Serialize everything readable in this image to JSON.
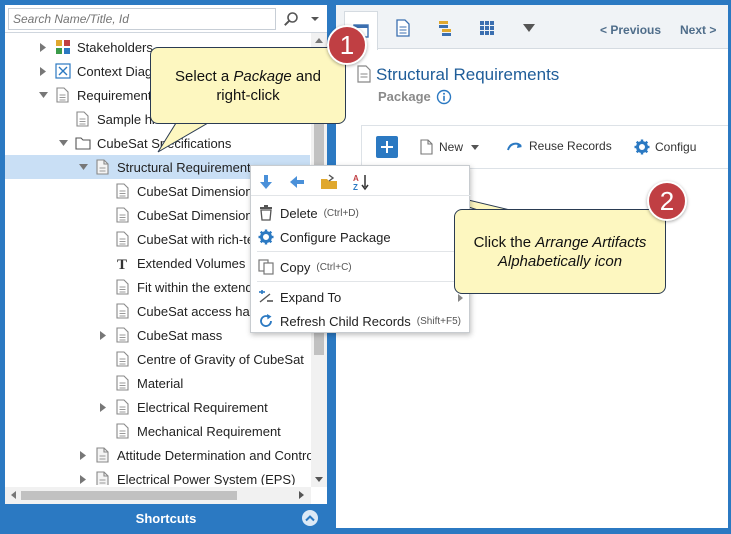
{
  "search": {
    "placeholder": "Search Name/Title, Id"
  },
  "tree": [
    {
      "label": "Stakeholders",
      "toggle": "collapsed",
      "icon": "stakeholders-icon",
      "indent": 1
    },
    {
      "label": "Context Diagram",
      "toggle": "collapsed",
      "icon": "context-diagram-icon",
      "indent": 1
    },
    {
      "label": "Requirements",
      "toggle": "expanded",
      "icon": "document-icon",
      "indent": 1
    },
    {
      "label": "Sample hi",
      "toggle": "none",
      "icon": "document-icon",
      "indent": 2
    },
    {
      "label": "CubeSat Specifications",
      "toggle": "expanded",
      "icon": "folder-icon",
      "indent": 2
    },
    {
      "label": "Structural Requirements",
      "toggle": "expanded",
      "icon": "package-icon",
      "indent": 3,
      "selected": true
    },
    {
      "label": "CubeSat Dimension",
      "toggle": "none",
      "icon": "document-icon",
      "indent": 4
    },
    {
      "label": "CubeSat Dimension",
      "toggle": "none",
      "icon": "document-icon",
      "indent": 4
    },
    {
      "label": "CubeSat with rich-text",
      "toggle": "none",
      "icon": "document-icon",
      "indent": 4
    },
    {
      "label": "Extended Volumes",
      "toggle": "none",
      "icon": "text-icon",
      "indent": 4
    },
    {
      "label": "Fit within the extended",
      "toggle": "none",
      "icon": "document-icon",
      "indent": 4
    },
    {
      "label": "CubeSat access hatch",
      "toggle": "none",
      "icon": "document-icon",
      "indent": 4
    },
    {
      "label": "CubeSat mass",
      "toggle": "collapsed",
      "icon": "document-icon",
      "indent": 4
    },
    {
      "label": "Centre of Gravity of CubeSat",
      "toggle": "none",
      "icon": "document-icon",
      "indent": 4
    },
    {
      "label": "Material",
      "toggle": "none",
      "icon": "document-icon",
      "indent": 4
    },
    {
      "label": "Electrical Requirement",
      "toggle": "collapsed",
      "icon": "document-icon",
      "indent": 4
    },
    {
      "label": "Mechanical Requirement",
      "toggle": "none",
      "icon": "document-icon",
      "indent": 4
    },
    {
      "label": "Attitude Determination and Control",
      "toggle": "collapsed",
      "icon": "package-icon",
      "indent": 3
    },
    {
      "label": "Electrical Power System (EPS)",
      "toggle": "collapsed",
      "icon": "package-icon",
      "indent": 3
    }
  ],
  "shortcuts": {
    "label": "Shortcuts"
  },
  "right_panel": {
    "tabs": [
      "tab-details-icon",
      "tab-document-icon",
      "tab-database-icon",
      "tab-grid-icon",
      "tab-more-icon"
    ],
    "previous_label": "< Previous",
    "next_label": "Next >",
    "title": "Structural Requirements",
    "subtitle": "Package",
    "toolbar": {
      "new_label": "New",
      "reuse_label": "Reuse Records",
      "configure_label": "Configu"
    }
  },
  "context_menu": {
    "icon_bar": [
      "move-down-icon",
      "move-left-icon",
      "move-to-folder-icon",
      "sort-az-icon"
    ],
    "items": [
      {
        "label": "Delete",
        "shortcut": "(Ctrl+D)",
        "icon": "trash-icon"
      },
      {
        "label": "Configure Package",
        "shortcut": "",
        "icon": "gear-icon"
      },
      {
        "label": "Copy",
        "shortcut": "(Ctrl+C)",
        "icon": "copy-icon"
      },
      {
        "label": "Expand To",
        "shortcut": "",
        "icon": "expand-to-icon"
      },
      {
        "label": "Refresh Child Records",
        "shortcut": "(Shift+F5)",
        "icon": "refresh-icon"
      }
    ]
  },
  "callouts": {
    "one": {
      "number": "1",
      "line1_a": "Select a ",
      "line1_em": "Package",
      "line1_b": " and",
      "line2": "right-click"
    },
    "two": {
      "number": "2",
      "line1_a": "Click the ",
      "line1_em": "Arrange Artifacts",
      "line2_em": "Alphabetically icon"
    }
  },
  "colors": {
    "brand": "#2b79c2",
    "selection": "#c9dff5",
    "callout_fill": "#fdf7c0",
    "badge": "#c03f43",
    "title": "#1f5d99"
  }
}
